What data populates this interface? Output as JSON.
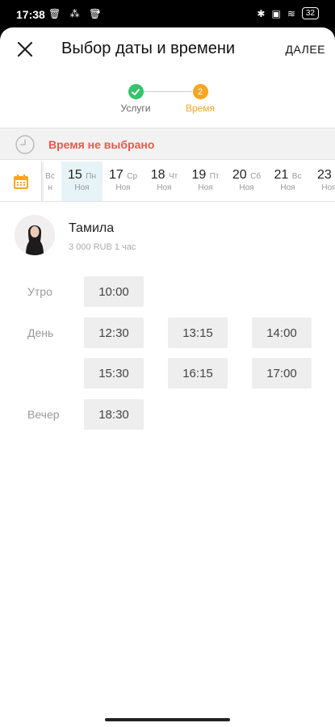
{
  "status_bar": {
    "time": "17:38",
    "left_icons": "🗑 ⁂ 🗑",
    "dot": "•",
    "right_icons": [
      "✱",
      "▣",
      "≋"
    ],
    "battery": "32"
  },
  "header": {
    "title": "Выбор даты и времени",
    "next_label": "ДАЛЕЕ"
  },
  "stepper": {
    "steps": [
      {
        "label": "Услуги",
        "state": "done",
        "color": "#35c46b"
      },
      {
        "label": "Время",
        "number": "2",
        "state": "active",
        "color": "#f5a623"
      }
    ]
  },
  "banner": {
    "text": "Время не выбрано",
    "color": "#e45a4a"
  },
  "dates": [
    {
      "num": "",
      "weekday": "Вс",
      "month": "н"
    },
    {
      "num": "15",
      "weekday": "Пн",
      "month": "Ноя",
      "selected": true
    },
    {
      "num": "17",
      "weekday": "Ср",
      "month": "Ноя"
    },
    {
      "num": "18",
      "weekday": "Чт",
      "month": "Ноя"
    },
    {
      "num": "19",
      "weekday": "Пт",
      "month": "Ноя"
    },
    {
      "num": "20",
      "weekday": "Сб",
      "month": "Ноя"
    },
    {
      "num": "21",
      "weekday": "Вс",
      "month": "Ноя"
    },
    {
      "num": "23",
      "weekday": "В",
      "month": "Ноя"
    }
  ],
  "master": {
    "name": "Тамила",
    "info": "3 000 RUB   1 час"
  },
  "slots": {
    "morning": {
      "label": "Утро",
      "times": [
        "10:00"
      ]
    },
    "day": {
      "label": "День",
      "times": [
        "12:30",
        "13:15",
        "14:00",
        "15:30",
        "16:15",
        "17:00"
      ]
    },
    "evening": {
      "label": "Вечер",
      "times": [
        "18:30"
      ]
    }
  }
}
